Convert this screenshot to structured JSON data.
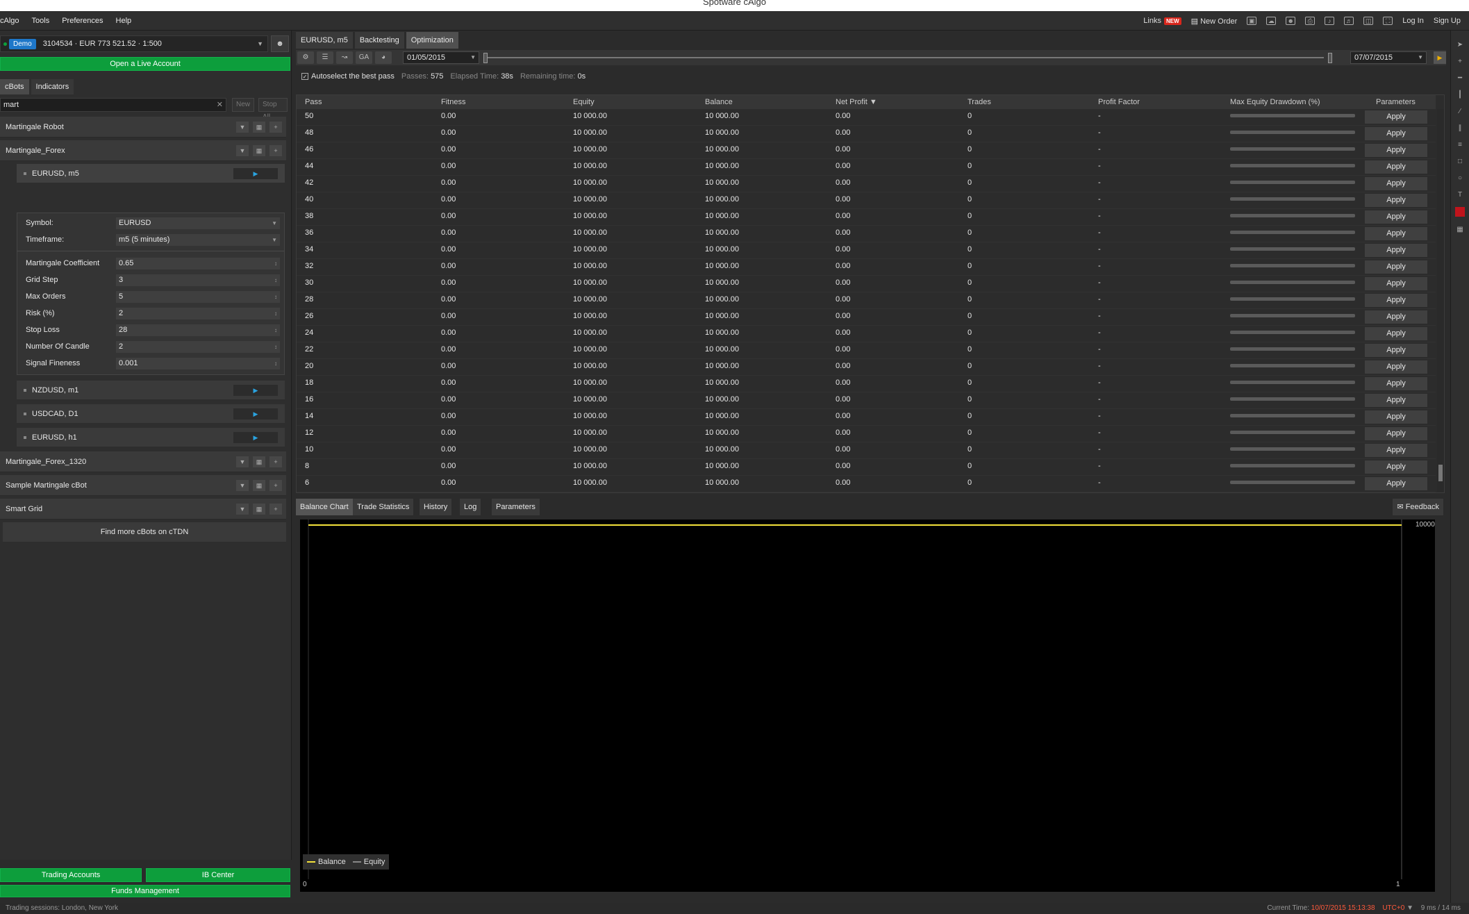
{
  "window": {
    "title": "Spotware cAlgo"
  },
  "menu": {
    "items": [
      "cAlgo",
      "Tools",
      "Preferences",
      "Help"
    ]
  },
  "header": {
    "links": "Links",
    "new_badge": "NEW",
    "new_order": "New Order",
    "login": "Log In",
    "signup": "Sign Up"
  },
  "account": {
    "demo": "Demo",
    "text": "3104534 · EUR 773 521.52 · 1:500"
  },
  "left": {
    "live_account": "Open a Live Account",
    "tabs": [
      "cBots",
      "Indicators"
    ],
    "search_value": "mart",
    "new_btn": "New",
    "stop_all_btn": "Stop All",
    "bots": [
      "Martingale Robot",
      "Martingale_Forex",
      "Martingale_Forex_1320",
      "Sample Martingale cBot",
      "Smart Grid"
    ],
    "instances": [
      "EURUSD, m5",
      "NZDUSD, m1",
      "USDCAD, D1",
      "EURUSD, h1"
    ],
    "params": {
      "symbol_label": "Symbol:",
      "symbol_value": "EURUSD",
      "timeframe_label": "Timeframe:",
      "timeframe_value": "m5 (5 minutes)",
      "items": [
        {
          "label": "Martingale Coefficient",
          "value": "0.65"
        },
        {
          "label": "Grid Step",
          "value": "3"
        },
        {
          "label": "Max Orders",
          "value": "5"
        },
        {
          "label": "Risk (%)",
          "value": "2"
        },
        {
          "label": "Stop Loss",
          "value": "28"
        },
        {
          "label": "Number Of Candle",
          "value": "2"
        },
        {
          "label": "Signal Fineness",
          "value": "0.001"
        }
      ]
    },
    "find_more": "Find more cBots on cTDN",
    "trading_accounts": "Trading Accounts",
    "ib_center": "IB Center",
    "funds": "Funds Management"
  },
  "main": {
    "tabs": [
      "EURUSD, m5",
      "Backtesting",
      "Optimization"
    ],
    "ga_label": "GA",
    "start_date": "01/05/2015",
    "end_date": "07/07/2015",
    "autoselect": "Autoselect the best pass",
    "passes_label": "Passes:",
    "passes_value": "575",
    "elapsed_label": "Elapsed Time:",
    "elapsed_value": "38s",
    "remaining_label": "Remaining time:",
    "remaining_value": "0s",
    "columns": [
      "Pass",
      "Fitness",
      "Equity",
      "Balance",
      "Net Profit",
      "Trades",
      "Profit Factor",
      "Max Equity Drawdown (%)",
      "Parameters"
    ],
    "rows": [
      {
        "pass": "50",
        "fitness": "0.00",
        "equity": "10 000.00",
        "balance": "10 000.00",
        "net": "0.00",
        "trades": "0",
        "pf": "-",
        "apply": "Apply"
      },
      {
        "pass": "48",
        "fitness": "0.00",
        "equity": "10 000.00",
        "balance": "10 000.00",
        "net": "0.00",
        "trades": "0",
        "pf": "-",
        "apply": "Apply"
      },
      {
        "pass": "46",
        "fitness": "0.00",
        "equity": "10 000.00",
        "balance": "10 000.00",
        "net": "0.00",
        "trades": "0",
        "pf": "-",
        "apply": "Apply"
      },
      {
        "pass": "44",
        "fitness": "0.00",
        "equity": "10 000.00",
        "balance": "10 000.00",
        "net": "0.00",
        "trades": "0",
        "pf": "-",
        "apply": "Apply"
      },
      {
        "pass": "42",
        "fitness": "0.00",
        "equity": "10 000.00",
        "balance": "10 000.00",
        "net": "0.00",
        "trades": "0",
        "pf": "-",
        "apply": "Apply"
      },
      {
        "pass": "40",
        "fitness": "0.00",
        "equity": "10 000.00",
        "balance": "10 000.00",
        "net": "0.00",
        "trades": "0",
        "pf": "-",
        "apply": "Apply"
      },
      {
        "pass": "38",
        "fitness": "0.00",
        "equity": "10 000.00",
        "balance": "10 000.00",
        "net": "0.00",
        "trades": "0",
        "pf": "-",
        "apply": "Apply"
      },
      {
        "pass": "36",
        "fitness": "0.00",
        "equity": "10 000.00",
        "balance": "10 000.00",
        "net": "0.00",
        "trades": "0",
        "pf": "-",
        "apply": "Apply"
      },
      {
        "pass": "34",
        "fitness": "0.00",
        "equity": "10 000.00",
        "balance": "10 000.00",
        "net": "0.00",
        "trades": "0",
        "pf": "-",
        "apply": "Apply"
      },
      {
        "pass": "32",
        "fitness": "0.00",
        "equity": "10 000.00",
        "balance": "10 000.00",
        "net": "0.00",
        "trades": "0",
        "pf": "-",
        "apply": "Apply"
      },
      {
        "pass": "30",
        "fitness": "0.00",
        "equity": "10 000.00",
        "balance": "10 000.00",
        "net": "0.00",
        "trades": "0",
        "pf": "-",
        "apply": "Apply"
      },
      {
        "pass": "28",
        "fitness": "0.00",
        "equity": "10 000.00",
        "balance": "10 000.00",
        "net": "0.00",
        "trades": "0",
        "pf": "-",
        "apply": "Apply"
      },
      {
        "pass": "26",
        "fitness": "0.00",
        "equity": "10 000.00",
        "balance": "10 000.00",
        "net": "0.00",
        "trades": "0",
        "pf": "-",
        "apply": "Apply"
      },
      {
        "pass": "24",
        "fitness": "0.00",
        "equity": "10 000.00",
        "balance": "10 000.00",
        "net": "0.00",
        "trades": "0",
        "pf": "-",
        "apply": "Apply"
      },
      {
        "pass": "22",
        "fitness": "0.00",
        "equity": "10 000.00",
        "balance": "10 000.00",
        "net": "0.00",
        "trades": "0",
        "pf": "-",
        "apply": "Apply"
      },
      {
        "pass": "20",
        "fitness": "0.00",
        "equity": "10 000.00",
        "balance": "10 000.00",
        "net": "0.00",
        "trades": "0",
        "pf": "-",
        "apply": "Apply"
      },
      {
        "pass": "18",
        "fitness": "0.00",
        "equity": "10 000.00",
        "balance": "10 000.00",
        "net": "0.00",
        "trades": "0",
        "pf": "-",
        "apply": "Apply"
      },
      {
        "pass": "16",
        "fitness": "0.00",
        "equity": "10 000.00",
        "balance": "10 000.00",
        "net": "0.00",
        "trades": "0",
        "pf": "-",
        "apply": "Apply"
      },
      {
        "pass": "14",
        "fitness": "0.00",
        "equity": "10 000.00",
        "balance": "10 000.00",
        "net": "0.00",
        "trades": "0",
        "pf": "-",
        "apply": "Apply"
      },
      {
        "pass": "12",
        "fitness": "0.00",
        "equity": "10 000.00",
        "balance": "10 000.00",
        "net": "0.00",
        "trades": "0",
        "pf": "-",
        "apply": "Apply"
      },
      {
        "pass": "10",
        "fitness": "0.00",
        "equity": "10 000.00",
        "balance": "10 000.00",
        "net": "0.00",
        "trades": "0",
        "pf": "-",
        "apply": "Apply"
      },
      {
        "pass": "8",
        "fitness": "0.00",
        "equity": "10 000.00",
        "balance": "10 000.00",
        "net": "0.00",
        "trades": "0",
        "pf": "-",
        "apply": "Apply"
      },
      {
        "pass": "6",
        "fitness": "0.00",
        "equity": "10 000.00",
        "balance": "10 000.00",
        "net": "0.00",
        "trades": "0",
        "pf": "-",
        "apply": "Apply"
      }
    ],
    "bottom_tabs": [
      "Balance Chart",
      "Trade Statistics",
      "History",
      "Log",
      "Parameters"
    ],
    "feedback": "Feedback",
    "chart": {
      "y_label": "10000",
      "x_start": "0",
      "x_end": "1",
      "legend_balance": "Balance",
      "legend_equity": "Equity"
    }
  },
  "status": {
    "sessions": "Trading sessions:  London, New York",
    "current_time_label": "Current Time:",
    "current_time": "10/07/2015 15:13:38",
    "tz": "UTC+0",
    "latency": "9 ms / 14 ms"
  },
  "colors": {
    "accent_green": "#0d9e3c",
    "demo_blue": "#1e77c9",
    "balance_line": "#f4e23a",
    "time_red": "#ff5a3c"
  },
  "chart_data": {
    "type": "line",
    "x": [
      0,
      1
    ],
    "series": [
      {
        "name": "Balance",
        "values": [
          10000,
          10000
        ]
      },
      {
        "name": "Equity",
        "values": [
          10000,
          10000
        ]
      }
    ]
  }
}
